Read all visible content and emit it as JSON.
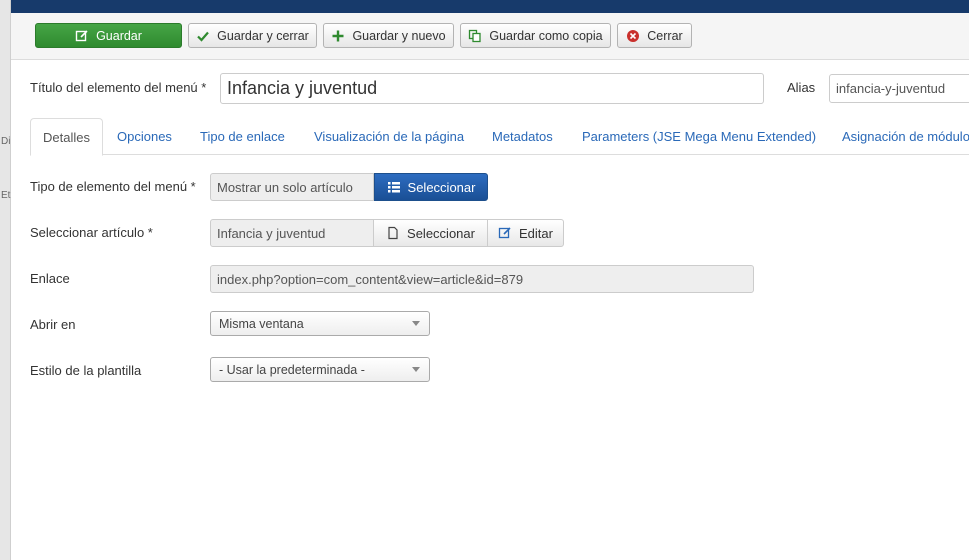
{
  "toolbar": {
    "save": "Guardar",
    "save_close": "Guardar y cerrar",
    "save_new": "Guardar y nuevo",
    "save_copy": "Guardar como copia",
    "close": "Cerrar"
  },
  "title_field": {
    "label": "Título del elemento del menú *",
    "value": "Infancia y juventud"
  },
  "alias_field": {
    "label": "Alias",
    "value": "infancia-y-juventud"
  },
  "tabs": [
    {
      "label": "Detalles"
    },
    {
      "label": "Opciones"
    },
    {
      "label": "Tipo de enlace"
    },
    {
      "label": "Visualización de la página"
    },
    {
      "label": "Metadatos"
    },
    {
      "label": "Parameters (JSE Mega Menu Extended)"
    },
    {
      "label": "Asignación de módulo"
    }
  ],
  "details": {
    "menu_item_type": {
      "label": "Tipo de elemento del menú *",
      "value": "Mostrar un solo artículo",
      "button": "Seleccionar"
    },
    "select_article": {
      "label": "Seleccionar artículo *",
      "value": "Infancia y juventud",
      "select_button": "Seleccionar",
      "edit_button": "Editar"
    },
    "link": {
      "label": "Enlace",
      "value": "index.php?option=com_content&view=article&id=879"
    },
    "open_in": {
      "label": "Abrir en",
      "value": "Misma ventana"
    },
    "template_style": {
      "label": "Estilo de la plantilla",
      "value": "- Usar la predeterminada -"
    }
  },
  "left_edge_fragments": [
    "Di",
    "Et"
  ],
  "colors": {
    "topbar": "#173A6B",
    "save_green": "#3A9A3A",
    "select_blue": "#1F5BA8",
    "link_blue": "#2A69B8"
  }
}
